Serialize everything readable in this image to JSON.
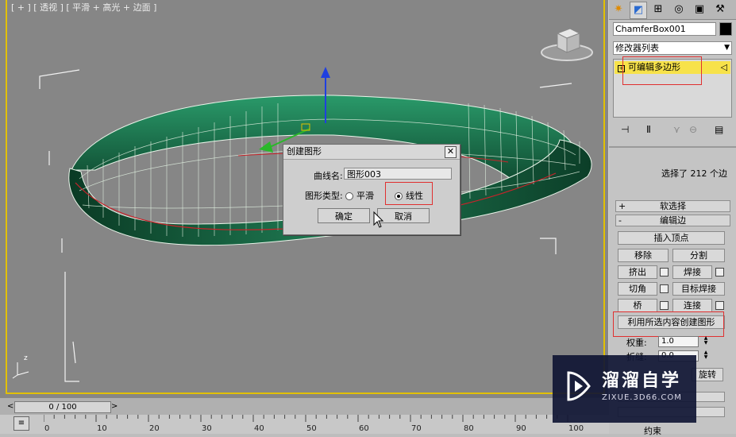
{
  "viewport": {
    "label": "[ + ] [ 透视 ] [ 平滑 + 高光 + 边面 ]"
  },
  "dialog": {
    "title": "创建图形",
    "close_glyph": "✕",
    "curve_name_label": "曲线名:",
    "curve_name_value": "图形003",
    "shape_type_label": "图形类型:",
    "option_smooth": "平滑",
    "option_linear": "线性",
    "selected_option": "线性",
    "ok_label": "确定",
    "cancel_label": "取消"
  },
  "panel": {
    "object_name": "ChamferBox001",
    "object_color": "#000000",
    "modifier_list_label": "修改器列表",
    "stack_item": "可编辑多边形",
    "selection_info": "选择了 212 个边",
    "rollout_soft": "软选择",
    "rollout_soft_sign": "+",
    "rollout_edit_edges": "编辑边",
    "rollout_edit_sign": "-",
    "buttons": {
      "insert_vertex": "插入顶点",
      "remove": "移除",
      "split": "分割",
      "extrude": "挤出",
      "weld": "焊接",
      "chamfer": "切角",
      "target_weld": "目标焊接",
      "bridge": "桥",
      "connect": "连接",
      "create_shape": "利用所选内容创建图形"
    },
    "weight_label": "权重:",
    "weight_value": "1.0",
    "crease_label": "折缝:",
    "crease_value": "0.0",
    "rotate_label": "旋转",
    "bottom_label": "约束"
  },
  "timeline": {
    "frame_display": "0 / 100",
    "left_arrow": "<",
    "right_arrow": ">",
    "ticks": [
      "0",
      "10",
      "20",
      "30",
      "40",
      "50",
      "60",
      "70",
      "80",
      "90",
      "100"
    ]
  },
  "axis_label": "z",
  "watermark": {
    "title": "溜溜自学",
    "subtitle": "ZIXUE.3D66.COM"
  },
  "colors": {
    "highlight_red": "#e03030",
    "stack_yellow": "#f7e24a",
    "viewport_border": "#e2c000",
    "mesh_green": "#1f7a52"
  }
}
